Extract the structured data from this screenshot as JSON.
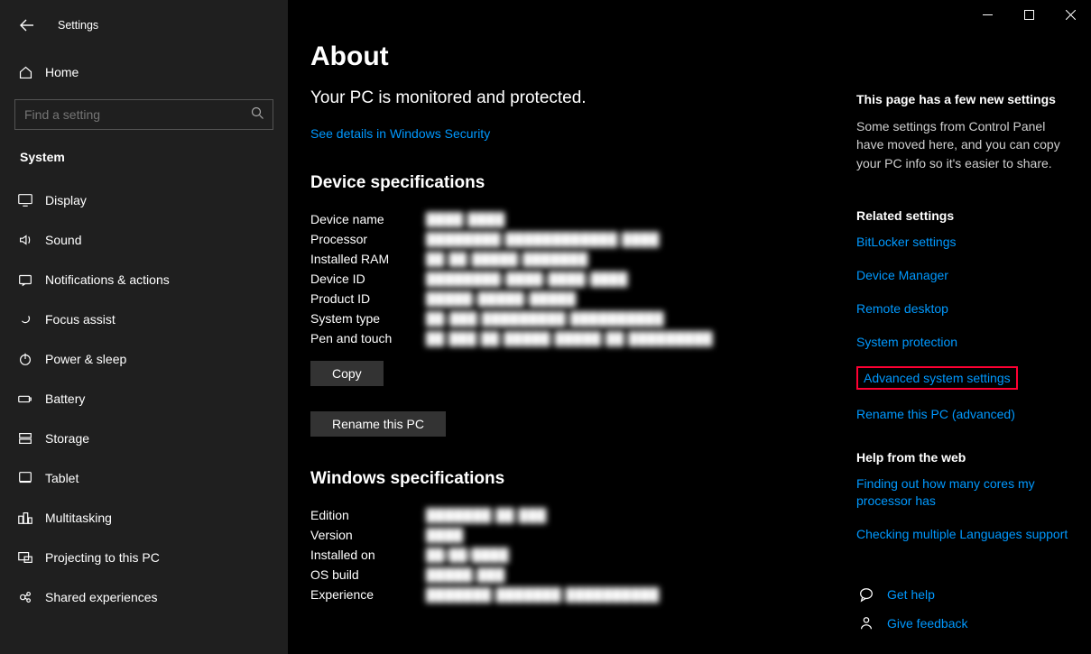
{
  "window": {
    "title": "Settings",
    "search_placeholder": "Find a setting"
  },
  "sidebar": {
    "home": "Home",
    "section": "System",
    "items": [
      {
        "label": "Display",
        "icon": "display"
      },
      {
        "label": "Sound",
        "icon": "sound"
      },
      {
        "label": "Notifications & actions",
        "icon": "notifications"
      },
      {
        "label": "Focus assist",
        "icon": "focus"
      },
      {
        "label": "Power & sleep",
        "icon": "power"
      },
      {
        "label": "Battery",
        "icon": "battery"
      },
      {
        "label": "Storage",
        "icon": "storage"
      },
      {
        "label": "Tablet",
        "icon": "tablet"
      },
      {
        "label": "Multitasking",
        "icon": "multitask"
      },
      {
        "label": "Projecting to this PC",
        "icon": "project"
      },
      {
        "label": "Shared experiences",
        "icon": "shared"
      }
    ]
  },
  "main": {
    "title": "About",
    "subhead": "Your PC is monitored and protected.",
    "security_link": "See details in Windows Security",
    "device_spec_heading": "Device specifications",
    "device_specs": [
      {
        "label": "Device name",
        "value": "████ ████"
      },
      {
        "label": "Processor",
        "value": "████████ ████████████ ████"
      },
      {
        "label": "Installed RAM",
        "value": "██ ██ █████ ███████"
      },
      {
        "label": "Device ID",
        "value": "████████-████-████-████"
      },
      {
        "label": "Product ID",
        "value": "█████-█████-█████"
      },
      {
        "label": "System type",
        "value": "██-███ █████████ ██████████"
      },
      {
        "label": "Pen and touch",
        "value": "██ ███ ██ █████ █████ ██ █████████"
      }
    ],
    "copy_btn": "Copy",
    "rename_btn": "Rename this PC",
    "win_spec_heading": "Windows specifications",
    "win_specs": [
      {
        "label": "Edition",
        "value": "███████ ██ ███"
      },
      {
        "label": "Version",
        "value": "████"
      },
      {
        "label": "Installed on",
        "value": "██/██/████"
      },
      {
        "label": "OS build",
        "value": "█████.███"
      },
      {
        "label": "Experience",
        "value": "███████ ███████ ██████████"
      }
    ]
  },
  "right": {
    "new_heading": "This page has a few new settings",
    "new_body": "Some settings from Control Panel have moved here, and you can copy your PC info so it's easier to share.",
    "related_heading": "Related settings",
    "related_links": [
      "BitLocker settings",
      "Device Manager",
      "Remote desktop",
      "System protection",
      "Advanced system settings",
      "Rename this PC (advanced)"
    ],
    "help_heading": "Help from the web",
    "help_links": [
      "Finding out how many cores my processor has",
      "Checking multiple Languages support"
    ],
    "get_help": "Get help",
    "give_feedback": "Give feedback"
  }
}
